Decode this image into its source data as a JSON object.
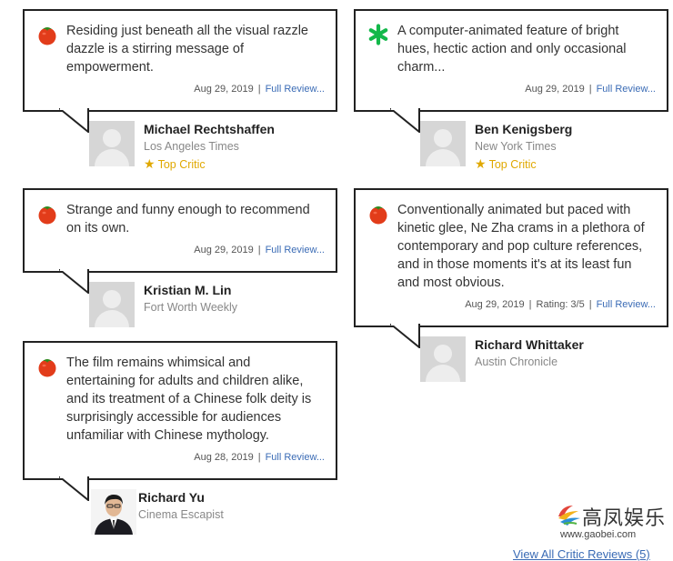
{
  "reviews": [
    {
      "icon": "fresh-tomato",
      "quote": "Residing just beneath all the visual razzle dazzle is a stirring message of empowerment.",
      "date": "Aug 29, 2019",
      "rating": "",
      "link": "Full Review...",
      "critic": "Michael Rechtshaffen",
      "publication": "Los Angeles Times",
      "top_critic": "Top Critic"
    },
    {
      "icon": "rotten-splat",
      "quote": "A computer-animated feature of bright hues, hectic action and only occasional charm...",
      "date": "Aug 29, 2019",
      "rating": "",
      "link": "Full Review...",
      "critic": "Ben Kenigsberg",
      "publication": "New York Times",
      "top_critic": "Top Critic"
    },
    {
      "icon": "fresh-tomato",
      "quote": "Strange and funny enough to recommend on its own.",
      "date": "Aug 29, 2019",
      "rating": "",
      "link": "Full Review...",
      "critic": "Kristian M. Lin",
      "publication": "Fort Worth Weekly"
    },
    {
      "icon": "fresh-tomato",
      "quote": "Conventionally animated but paced with kinetic glee, Ne Zha crams in a plethora of contemporary and pop culture references, and in those moments it's at its least fun and most obvious.",
      "date": "Aug 29, 2019",
      "rating": "Rating: 3/5",
      "link": "Full Review...",
      "critic": "Richard Whittaker",
      "publication": "Austin Chronicle"
    },
    {
      "icon": "fresh-tomato",
      "quote": "The film remains whimsical and entertaining for adults and children alike, and its treatment of a Chinese folk deity is surprisingly accessible for audiences unfamiliar with Chinese mythology.",
      "date": "Aug 28, 2019",
      "rating": "",
      "link": "Full Review...",
      "critic": "Richard Yu",
      "publication": "Cinema Escapist"
    }
  ],
  "separator": "|",
  "watermark": {
    "text": "高凤娱乐",
    "url": "www.gaobei.com"
  },
  "footer": {
    "view_all": "View All Critic Reviews (5)"
  },
  "colors": {
    "tomato": "#e23c1a",
    "splat": "#12b84a",
    "link": "#3a6bb5",
    "top_critic": "#e0a800"
  }
}
